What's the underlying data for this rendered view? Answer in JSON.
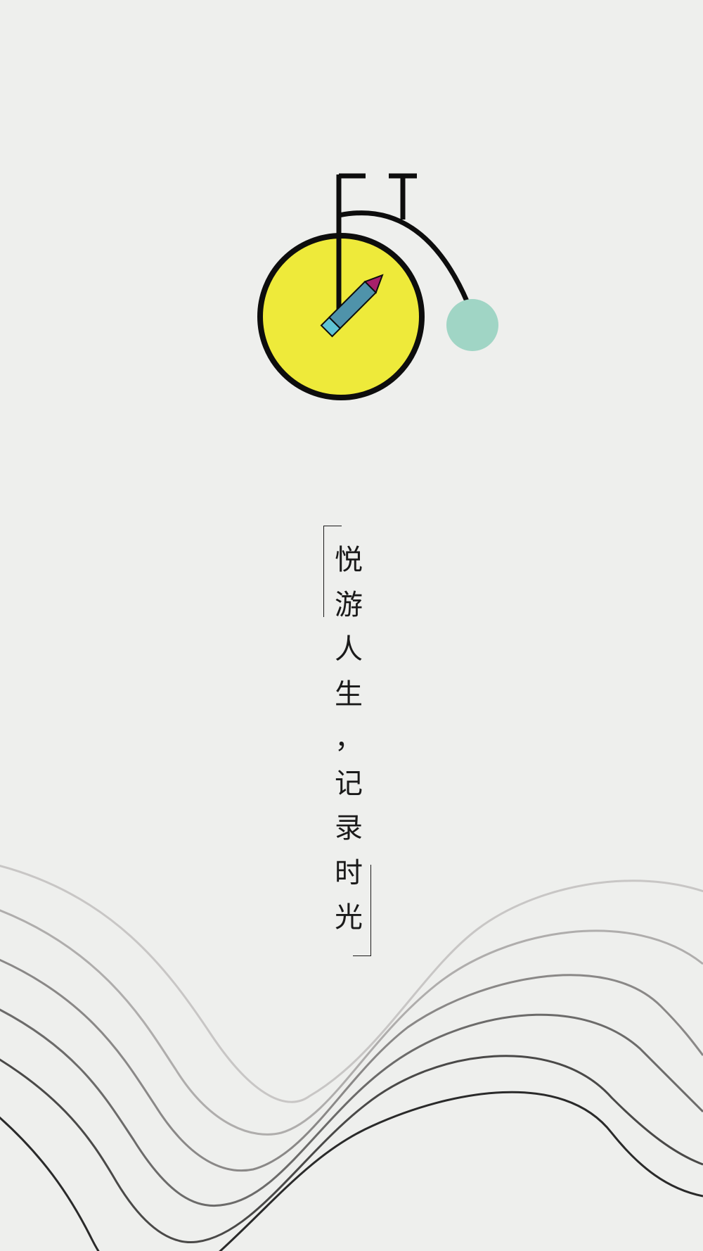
{
  "logo": {
    "icon": "bicycle-pen-logo-icon",
    "colors": {
      "wheel_fill": "#eeea3a",
      "stroke": "#0d0d0d",
      "small_wheel": "#a0d5c5",
      "pen_body": "#4f93aa",
      "pen_end": "#5fc3d4",
      "pen_tip": "#a8206a"
    }
  },
  "slogan": {
    "characters": [
      "悦",
      "游",
      "人",
      "生",
      "，",
      "记",
      "录",
      "时",
      "光"
    ]
  },
  "waves": {
    "icon": "decorative-wave-lines",
    "colors": [
      "#c8c6c5",
      "#afadac",
      "#8a8887",
      "#6c6b6a",
      "#4a4948",
      "#2a2a2a"
    ]
  }
}
